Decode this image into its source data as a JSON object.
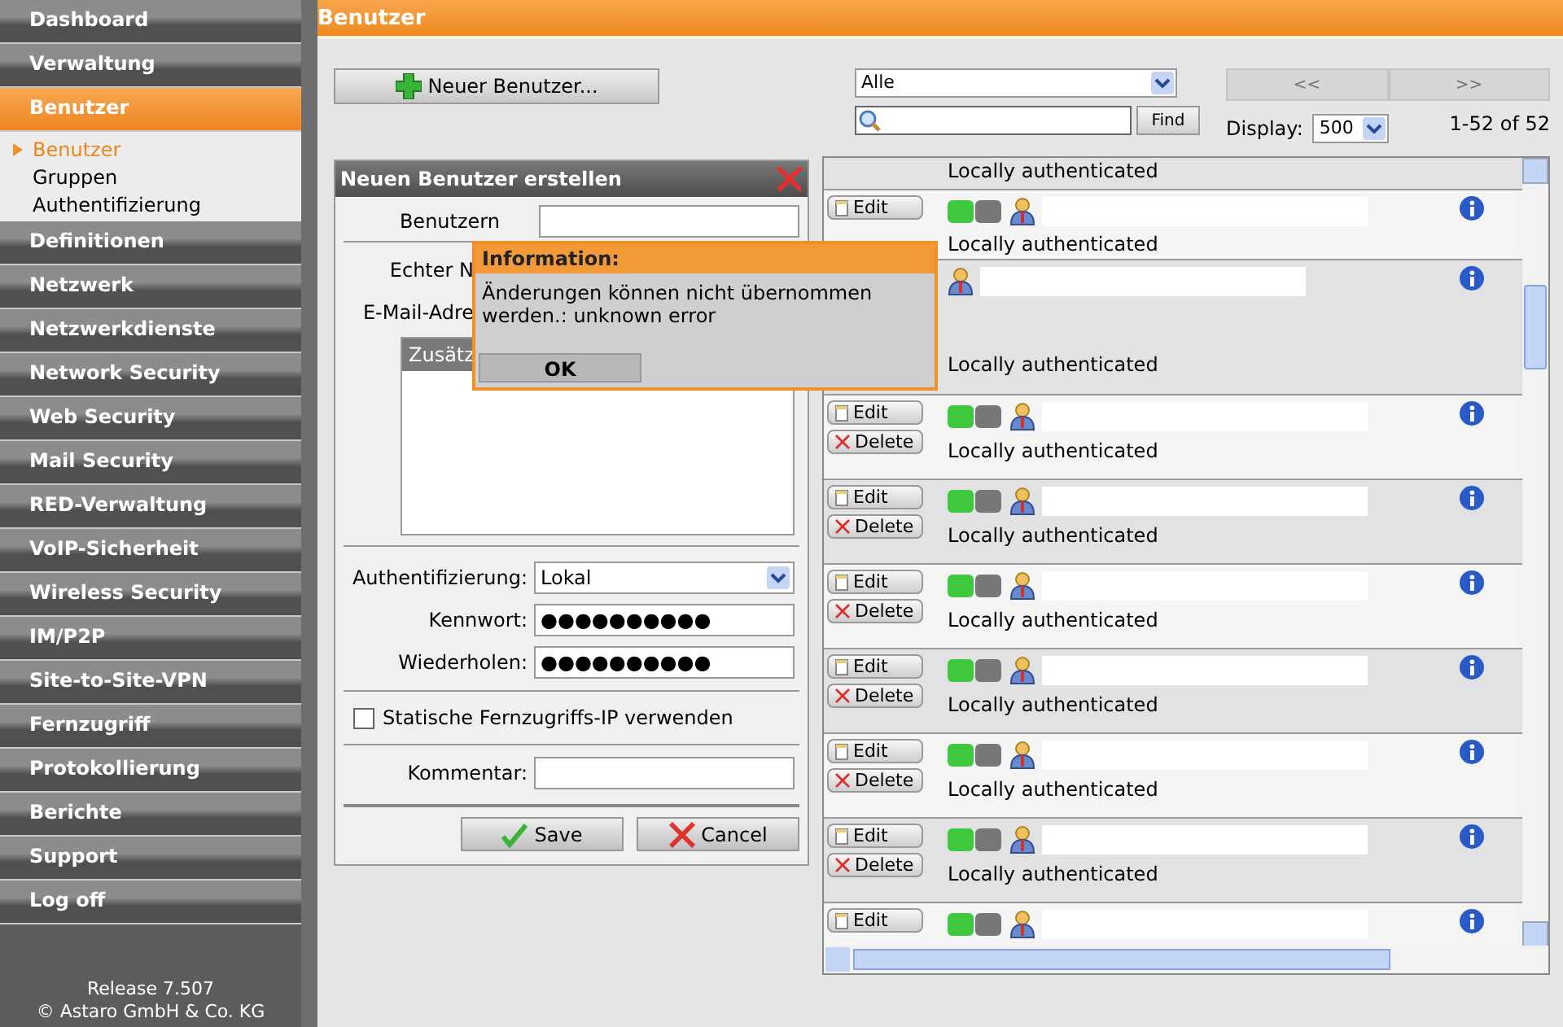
{
  "sidebar": {
    "items": [
      {
        "label": "Dashboard",
        "selected": false
      },
      {
        "label": "Verwaltung",
        "selected": false
      },
      {
        "label": "Benutzer",
        "selected": true,
        "children": [
          {
            "label": "Benutzer",
            "selected": true
          },
          {
            "label": "Gruppen",
            "selected": false
          },
          {
            "label": "Authentifizierung",
            "selected": false
          }
        ]
      },
      {
        "label": "Definitionen",
        "selected": false
      },
      {
        "label": "Netzwerk",
        "selected": false
      },
      {
        "label": "Netzwerkdienste",
        "selected": false
      },
      {
        "label": "Network Security",
        "selected": false
      },
      {
        "label": "Web Security",
        "selected": false
      },
      {
        "label": "Mail Security",
        "selected": false
      },
      {
        "label": "RED-Verwaltung",
        "selected": false
      },
      {
        "label": "VoIP-Sicherheit",
        "selected": false
      },
      {
        "label": "Wireless Security",
        "selected": false
      },
      {
        "label": "IM/P2P",
        "selected": false
      },
      {
        "label": "Site-to-Site-VPN",
        "selected": false
      },
      {
        "label": "Fernzugriff",
        "selected": false
      },
      {
        "label": "Protokollierung",
        "selected": false
      },
      {
        "label": "Berichte",
        "selected": false
      },
      {
        "label": "Support",
        "selected": false
      },
      {
        "label": "Log off",
        "selected": false
      }
    ],
    "footer": [
      "Release 7.507",
      "© Astaro GmbH & Co. KG"
    ]
  },
  "header": {
    "title": "Benutzer"
  },
  "new_button": "Neuer Benutzer...",
  "filter": {
    "value": "Alle"
  },
  "search": {
    "button": "Find"
  },
  "pager": {
    "prev": "<<",
    "next": ">>",
    "display_label": "Display:",
    "display_value": "500",
    "count": "1-52 of 52"
  },
  "form": {
    "title": "Neuen Benutzer erstellen",
    "cut_labels": [
      "Benutzern",
      "Echter N",
      "E-Mail-Adre"
    ],
    "extra_header": "Zusätz",
    "auth_label": "Authentifizierung:",
    "auth_value": "Lokal",
    "password_label": "Kennwort:",
    "password_value": "●●●●●●●●●●",
    "repeat_label": "Wiederholen:",
    "repeat_value": "●●●●●●●●●●",
    "static_ip": {
      "label": "Statische Fernzugriffs-IP verwenden",
      "checked": false
    },
    "comment_label": "Kommentar:",
    "save": "Save",
    "cancel": "Cancel"
  },
  "dialog": {
    "title": "Information:",
    "message": "Änderungen können nicht übernommen werden.: unknown error",
    "button": "OK"
  },
  "users": [
    {
      "kind": "partial_top",
      "auth": "Locally authenticated",
      "redacted": false
    },
    {
      "kind": "row",
      "edit": "Edit",
      "enabled": true,
      "auth": "Locally authenticated",
      "redacted": true
    },
    {
      "kind": "covered",
      "auth": "Locally authenticated",
      "redacted": true
    },
    {
      "kind": "row",
      "edit": "Edit",
      "delete": "Delete",
      "enabled": true,
      "auth": "Locally authenticated",
      "redacted": true
    },
    {
      "kind": "row",
      "edit": "Edit",
      "delete": "Delete",
      "enabled": true,
      "auth": "Locally authenticated",
      "redacted": true
    },
    {
      "kind": "row",
      "edit": "Edit",
      "delete": "Delete",
      "enabled": true,
      "auth": "Locally authenticated",
      "redacted": true
    },
    {
      "kind": "row",
      "edit": "Edit",
      "delete": "Delete",
      "enabled": true,
      "auth": "Locally authenticated",
      "redacted": true
    },
    {
      "kind": "row",
      "edit": "Edit",
      "delete": "Delete",
      "enabled": true,
      "auth": "Locally authenticated",
      "redacted": true
    },
    {
      "kind": "row",
      "edit": "Edit",
      "delete": "Delete",
      "enabled": true,
      "auth": "Locally authenticated",
      "redacted": true
    },
    {
      "kind": "partial_bottom",
      "edit": "Edit",
      "enabled": true,
      "redacted": true
    }
  ]
}
